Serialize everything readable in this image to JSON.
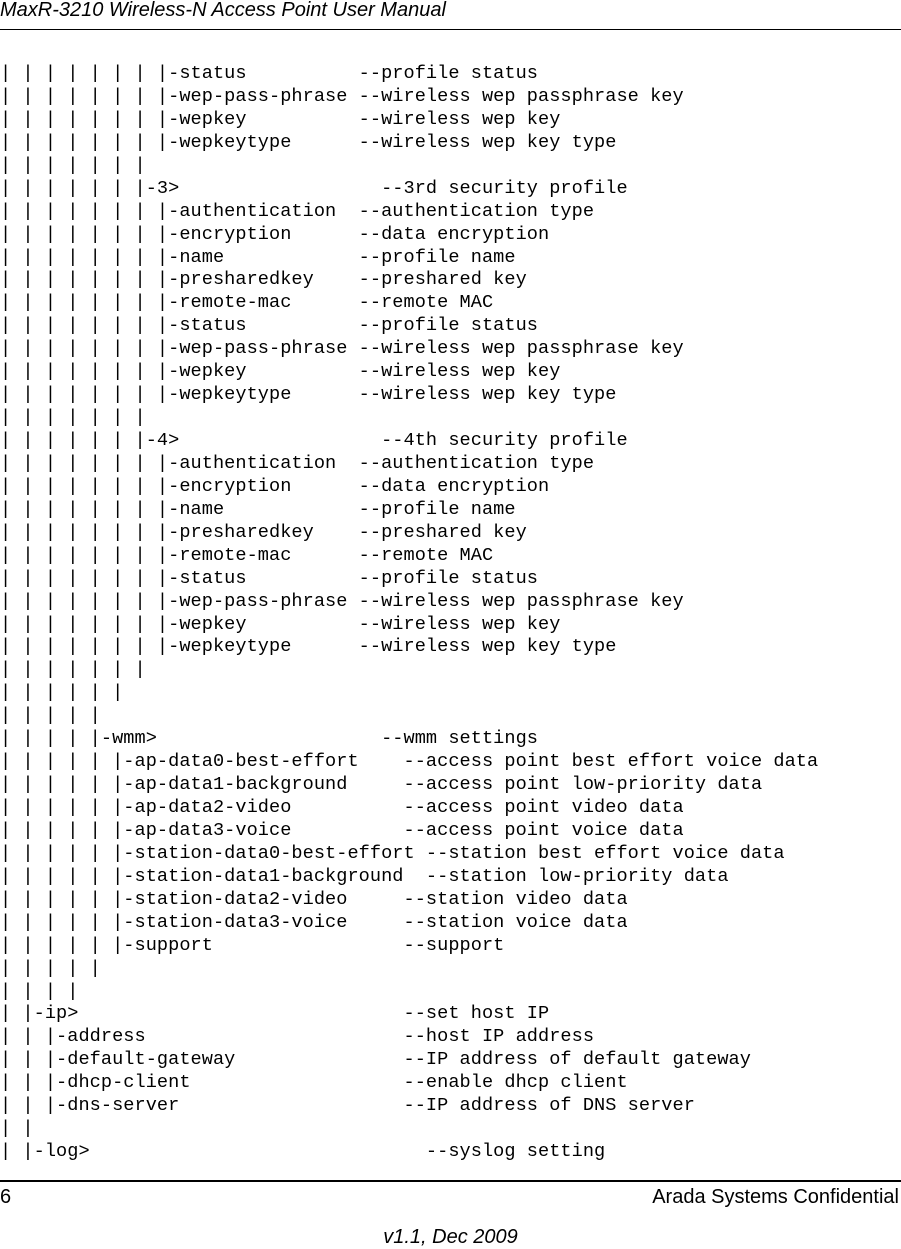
{
  "header": {
    "title": "MaxR-3210 Wireless-N Access Point User Manual"
  },
  "code_listing": {
    "lines": [
      "| | | | | | | |-status          --profile status",
      "| | | | | | | |-wep-pass-phrase --wireless wep passphrase key",
      "| | | | | | | |-wepkey          --wireless wep key",
      "| | | | | | | |-wepkeytype      --wireless wep key type",
      "| | | | | | |",
      "| | | | | | |-3>                  --3rd security profile",
      "| | | | | | | |-authentication  --authentication type",
      "| | | | | | | |-encryption      --data encryption",
      "| | | | | | | |-name            --profile name",
      "| | | | | | | |-presharedkey    --preshared key",
      "| | | | | | | |-remote-mac      --remote MAC",
      "| | | | | | | |-status          --profile status",
      "| | | | | | | |-wep-pass-phrase --wireless wep passphrase key",
      "| | | | | | | |-wepkey          --wireless wep key",
      "| | | | | | | |-wepkeytype      --wireless wep key type",
      "| | | | | | |",
      "| | | | | | |-4>                  --4th security profile",
      "| | | | | | | |-authentication  --authentication type",
      "| | | | | | | |-encryption      --data encryption",
      "| | | | | | | |-name            --profile name",
      "| | | | | | | |-presharedkey    --preshared key",
      "| | | | | | | |-remote-mac      --remote MAC",
      "| | | | | | | |-status          --profile status",
      "| | | | | | | |-wep-pass-phrase --wireless wep passphrase key",
      "| | | | | | | |-wepkey          --wireless wep key",
      "| | | | | | | |-wepkeytype      --wireless wep key type",
      "| | | | | | |",
      "| | | | | |",
      "| | | | |",
      "| | | | |-wmm>                    --wmm settings",
      "| | | | | |-ap-data0-best-effort    --access point best effort voice data",
      "| | | | | |-ap-data1-background     --access point low-priority data",
      "| | | | | |-ap-data2-video          --access point video data",
      "| | | | | |-ap-data3-voice          --access point voice data",
      "| | | | | |-station-data0-best-effort --station best effort voice data",
      "| | | | | |-station-data1-background  --station low-priority data",
      "| | | | | |-station-data2-video     --station video data",
      "| | | | | |-station-data3-voice     --station voice data",
      "| | | | | |-support                 --support",
      "| | | | |",
      "| | | |",
      "| |-ip>                             --set host IP",
      "| | |-address                       --host IP address",
      "| | |-default-gateway               --IP address of default gateway",
      "| | |-dhcp-client                   --enable dhcp client",
      "| | |-dns-server                    --IP address of DNS server",
      "| |",
      "| |-log>                              --syslog setting"
    ]
  },
  "footer": {
    "page_number": "6",
    "company": "Arada Systems Confidential",
    "version": "v1.1, Dec 2009"
  }
}
